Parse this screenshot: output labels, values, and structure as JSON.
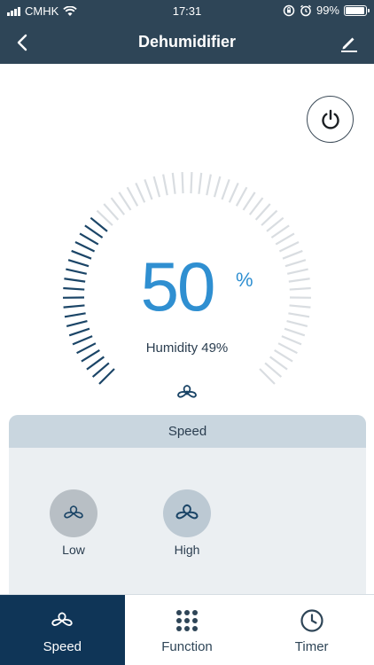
{
  "status": {
    "carrier": "CMHK",
    "time": "17:31",
    "battery": "99%",
    "battery_level": 0.99
  },
  "nav": {
    "title": "Dehumidifier"
  },
  "dial": {
    "value": "50",
    "unit": "%",
    "humidity_text": "Humidity 49%",
    "level": 0.5
  },
  "panel": {
    "header": "Speed",
    "options": [
      {
        "label": "Low"
      },
      {
        "label": "High"
      }
    ]
  },
  "tabs": [
    {
      "label": "Speed",
      "icon": "fan-icon"
    },
    {
      "label": "Function",
      "icon": "grid-dots-icon"
    },
    {
      "label": "Timer",
      "icon": "clock-icon"
    }
  ],
  "colors": {
    "header": "#2e4557",
    "accent": "#2f8fd1",
    "active_tab": "#0f3557",
    "tick_active": "#1b4567",
    "tick_inactive": "#d9dde1"
  }
}
